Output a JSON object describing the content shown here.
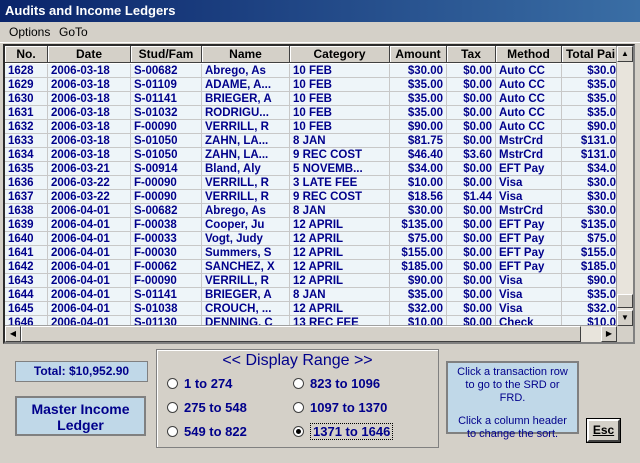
{
  "window": {
    "title": "Audits and Income Ledgers"
  },
  "menu": [
    {
      "label": "Options"
    },
    {
      "label": "GoTo"
    }
  ],
  "columns": [
    "No.",
    "Date",
    "Stud/Fam",
    "Name",
    "Category",
    "Amount",
    "Tax",
    "Method",
    "Total Pai"
  ],
  "rows": [
    [
      "1628",
      "2006-03-18",
      "S-00682",
      "Abrego, As",
      "10 FEB",
      "$30.00",
      "$0.00",
      "Auto CC",
      "$30.0"
    ],
    [
      "1629",
      "2006-03-18",
      "S-01109",
      "ADAME, A...",
      "10 FEB",
      "$35.00",
      "$0.00",
      "Auto CC",
      "$35.0"
    ],
    [
      "1630",
      "2006-03-18",
      "S-01141",
      "BRIEGER, A",
      "10 FEB",
      "$35.00",
      "$0.00",
      "Auto CC",
      "$35.0"
    ],
    [
      "1631",
      "2006-03-18",
      "S-01032",
      "RODRIGU...",
      "10 FEB",
      "$35.00",
      "$0.00",
      "Auto CC",
      "$35.0"
    ],
    [
      "1632",
      "2006-03-18",
      "F-00090",
      "VERRILL, R",
      "10 FEB",
      "$90.00",
      "$0.00",
      "Auto CC",
      "$90.0"
    ],
    [
      "1633",
      "2006-03-18",
      "S-01050",
      "ZAHN, LA...",
      "8 JAN",
      "$81.75",
      "$0.00",
      "MstrCrd",
      "$131.0"
    ],
    [
      "1634",
      "2006-03-18",
      "S-01050",
      "ZAHN, LA...",
      "9 REC COST",
      "$46.40",
      "$3.60",
      "MstrCrd",
      "$131.0"
    ],
    [
      "1635",
      "2006-03-21",
      "S-00914",
      "Bland, Aly",
      "5 NOVEMB...",
      "$34.00",
      "$0.00",
      "EFT Pay",
      "$34.0"
    ],
    [
      "1636",
      "2006-03-22",
      "F-00090",
      "VERRILL, R",
      "3 LATE FEE",
      "$10.00",
      "$0.00",
      "Visa",
      "$30.0"
    ],
    [
      "1637",
      "2006-03-22",
      "F-00090",
      "VERRILL, R",
      "9 REC COST",
      "$18.56",
      "$1.44",
      "Visa",
      "$30.0"
    ],
    [
      "1638",
      "2006-04-01",
      "S-00682",
      "Abrego, As",
      "8 JAN",
      "$30.00",
      "$0.00",
      "MstrCrd",
      "$30.0"
    ],
    [
      "1639",
      "2006-04-01",
      "F-00038",
      "Cooper, Ju",
      "12 APRIL",
      "$135.00",
      "$0.00",
      "EFT Pay",
      "$135.0"
    ],
    [
      "1640",
      "2006-04-01",
      "F-00033",
      "Vogt, Judy",
      "12 APRIL",
      "$75.00",
      "$0.00",
      "EFT Pay",
      "$75.0"
    ],
    [
      "1641",
      "2006-04-01",
      "F-00030",
      "Summers, S",
      "12 APRIL",
      "$155.00",
      "$0.00",
      "EFT Pay",
      "$155.0"
    ],
    [
      "1642",
      "2006-04-01",
      "F-00062",
      "SANCHEZ, X",
      "12 APRIL",
      "$185.00",
      "$0.00",
      "EFT Pay",
      "$185.0"
    ],
    [
      "1643",
      "2006-04-01",
      "F-00090",
      "VERRILL, R",
      "12 APRIL",
      "$90.00",
      "$0.00",
      "Visa",
      "$90.0"
    ],
    [
      "1644",
      "2006-04-01",
      "S-01141",
      "BRIEGER, A",
      "8 JAN",
      "$35.00",
      "$0.00",
      "Visa",
      "$35.0"
    ],
    [
      "1645",
      "2006-04-01",
      "S-01038",
      "CROUCH, ...",
      "12 APRIL",
      "$32.00",
      "$0.00",
      "Visa",
      "$32.0"
    ],
    [
      "1646",
      "2006-04-01",
      "S-01130",
      "DENNING, C",
      "13 REC FEE",
      "$10.00",
      "$0.00",
      "Check",
      "$10.0"
    ]
  ],
  "total_label": "Total: $10,952.90",
  "ledger_label": [
    "Master Income",
    "Ledger"
  ],
  "range": {
    "title": "<< Display Range >>",
    "options": [
      "1 to 274",
      "275 to 548",
      "549 to 822",
      "823 to 1096",
      "1097 to 1370",
      "1371 to 1646"
    ],
    "selected": "1371 to 1646"
  },
  "help": [
    "Click a transaction row to go to the SRD or FRD.",
    "Click a column header to change the sort."
  ],
  "esc_label": "Esc"
}
